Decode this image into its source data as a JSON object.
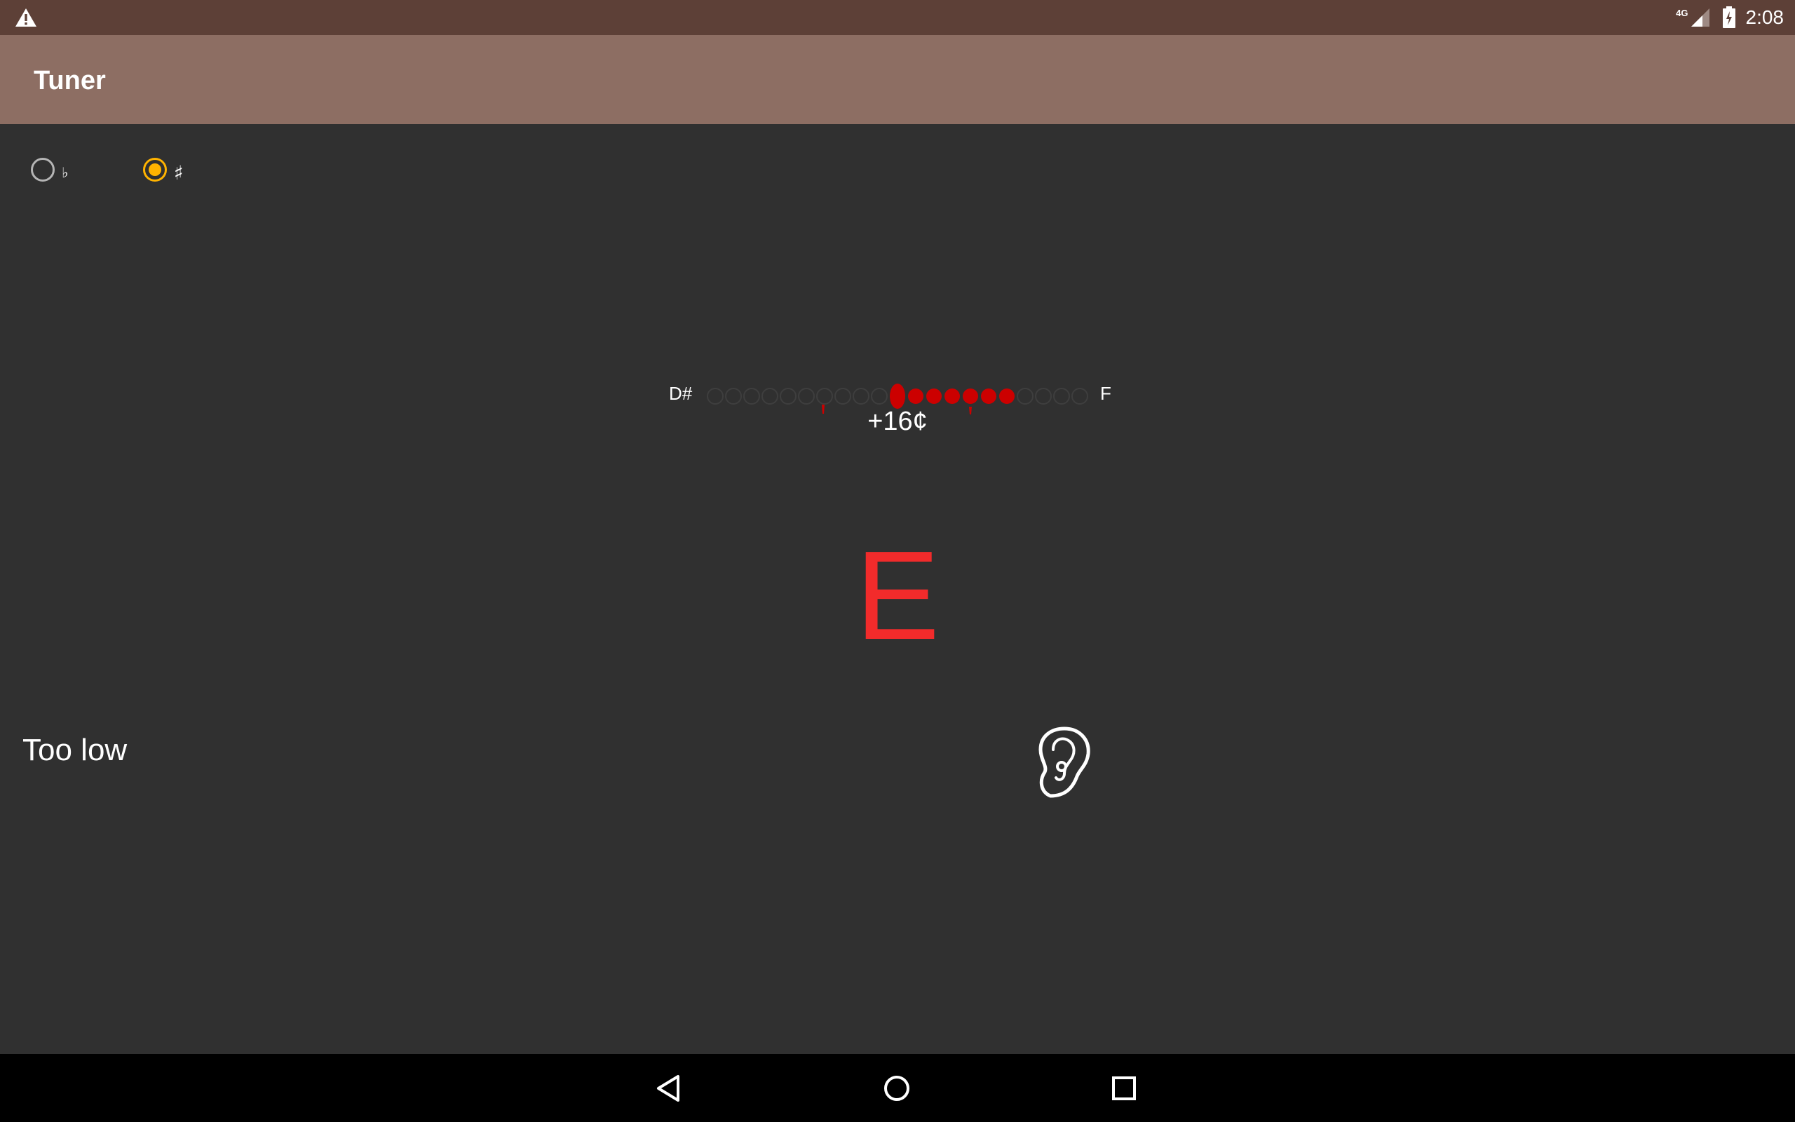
{
  "status_bar": {
    "network": "4G",
    "time": "2:08"
  },
  "app_bar": {
    "title": "Tuner"
  },
  "notation": {
    "flat": {
      "label": "♭",
      "checked": false
    },
    "sharp": {
      "label": "♯",
      "checked": true
    },
    "accent": "#ffb300"
  },
  "tuner": {
    "lower_note": "D#",
    "upper_note": "F",
    "cents_label": "+16¢",
    "meter_dots": 21,
    "detected_note": "E",
    "note_color": "#f22b2b",
    "status": "Too low"
  },
  "icons": {
    "warning": "warning-icon",
    "signal": "signal-icon",
    "battery": "battery-charging-icon",
    "ear": "ear-icon",
    "back": "back-icon",
    "home": "home-icon",
    "recents": "recents-icon"
  }
}
